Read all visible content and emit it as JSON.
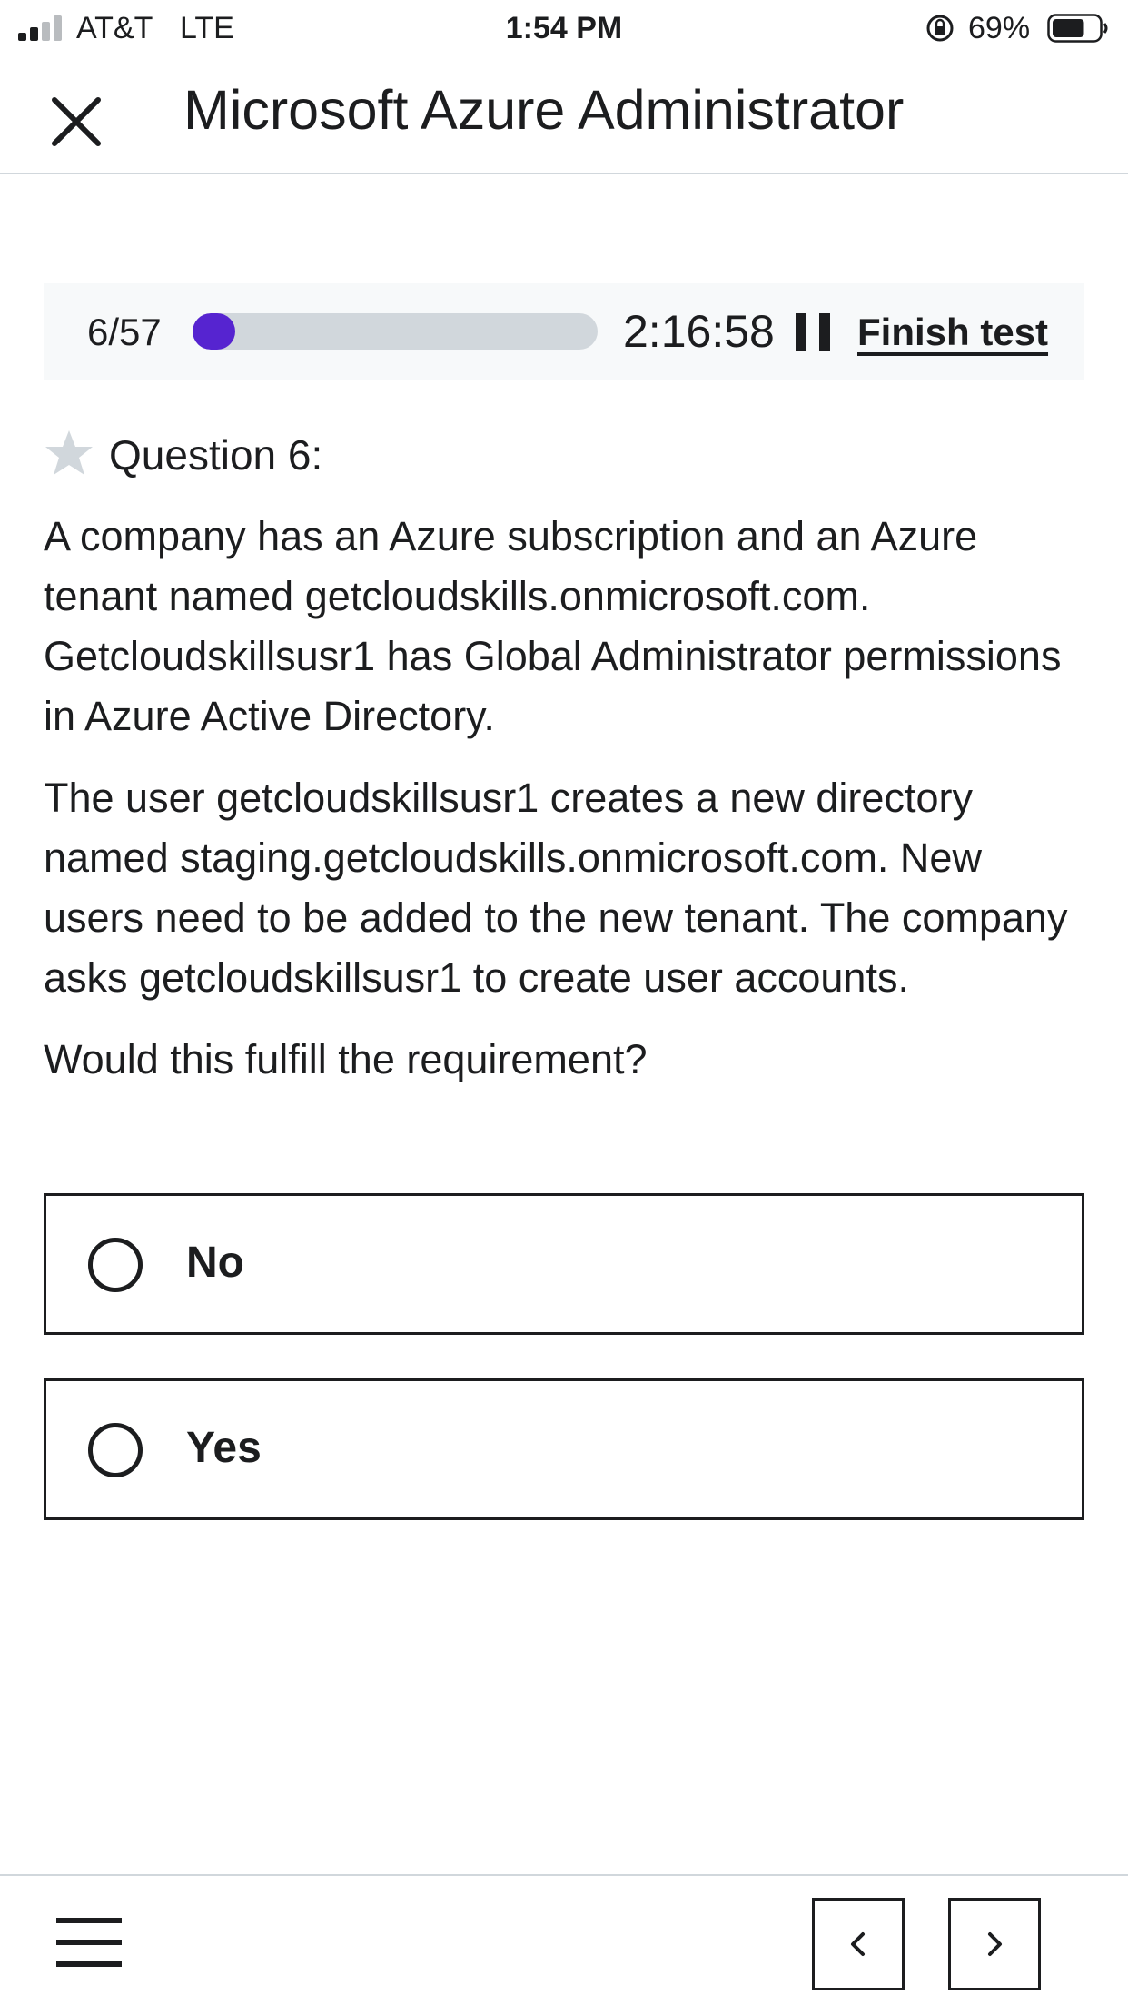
{
  "status_bar": {
    "carrier": "AT&T",
    "network": "LTE",
    "time": "1:54 PM",
    "battery_percent": "69%",
    "battery_level": 0.69
  },
  "header": {
    "title": "Microsoft Azure Administrator",
    "close_icon": "close-icon"
  },
  "progress": {
    "counter": "6/57",
    "current": 6,
    "total": 57,
    "timer": "2:16:58",
    "pause_icon": "pause-icon",
    "finish_label": "Finish test"
  },
  "question": {
    "label": "Question 6:",
    "star_icon": "star-icon",
    "paragraphs": [
      "A company has an Azure subscription and an Azure tenant named getcloudskills.onmicrosoft.com. Getcloudskillsusr1 has Global Administrator permissions in Azure Active Directory.",
      "The user getcloudskillsusr1 creates a new directory named staging.getcloudskills.onmicrosoft.com. New users need to be added to the new tenant. The company asks getcloudskillsusr1 to create user accounts.",
      "Would this fulfill the requirement?"
    ]
  },
  "options": [
    {
      "label": "No"
    },
    {
      "label": "Yes"
    }
  ],
  "footer": {
    "menu_icon": "menu-icon",
    "prev_icon": "chevron-left-icon",
    "next_icon": "chevron-right-icon"
  },
  "colors": {
    "text": "#1c1d1f",
    "accent": "#5624d0",
    "track": "#d1d7dc",
    "panel": "#f7f9fa",
    "star": "#d1d7dc",
    "divider": "#d1d7dc"
  }
}
